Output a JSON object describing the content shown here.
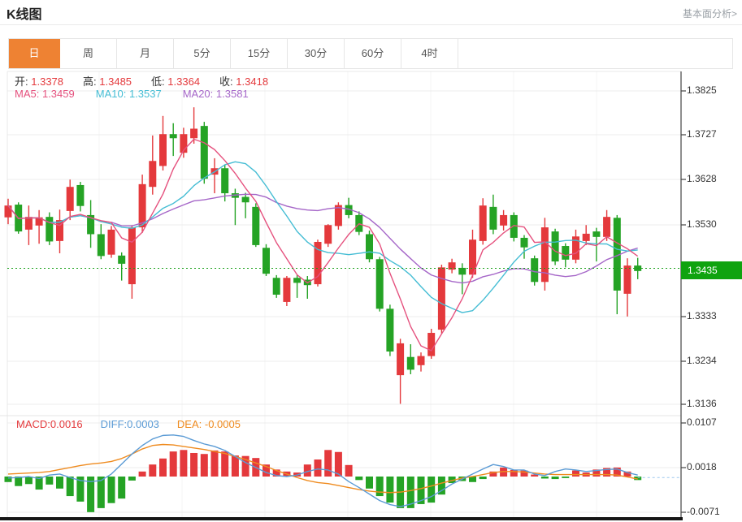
{
  "header": {
    "title": "K线图",
    "link": "基本面分析>"
  },
  "tabs": {
    "items": [
      "日",
      "周",
      "月",
      "5分",
      "15分",
      "30分",
      "60分",
      "4时"
    ],
    "active_index": 0
  },
  "readout": {
    "ohlc": [
      {
        "label": "开:",
        "value": "1.3378"
      },
      {
        "label": "高:",
        "value": "1.3485"
      },
      {
        "label": "低:",
        "value": "1.3364"
      },
      {
        "label": "收:",
        "value": "1.3418"
      }
    ],
    "ma": [
      {
        "label": "MA5:",
        "value": "1.3459"
      },
      {
        "label": "MA10:",
        "value": "1.3537"
      },
      {
        "label": "MA20:",
        "value": "1.3581"
      }
    ],
    "macd": [
      {
        "text": "MACD:0.0016"
      },
      {
        "text": "DIFF:0.0003"
      },
      {
        "text": "DEA: -0.0005"
      }
    ]
  },
  "colors": {
    "up": "#e4393c",
    "down": "#25a325",
    "ma5": "#e5517e",
    "ma10": "#45bdd4",
    "ma20": "#a566c8",
    "diff": "#5b9bd5",
    "dea": "#ef8b1f",
    "accent": "#ee8233",
    "price_tag": "#0fa30f",
    "price_line": "#18a018",
    "grid": "#ececec",
    "vgrid": "#f4f4f4",
    "axis": "#444444"
  },
  "chart_data": {
    "type": "candlestick+macd",
    "title": "K线图 daily candlestick with MA5/MA10/MA20 and MACD",
    "price_axis": {
      "tick_labels": [
        "1.3825",
        "1.3727",
        "1.3628",
        "1.3530",
        "1.3333",
        "1.3234",
        "1.3136"
      ],
      "tick_values": [
        1.3825,
        1.3727,
        1.3628,
        1.353,
        1.3333,
        1.3234,
        1.3136
      ],
      "current_price_label": "1.3435",
      "current_price": 1.3435,
      "range": [
        1.3111,
        1.3868
      ]
    },
    "candles_ohlc": [
      [
        1.3547,
        1.3588,
        1.3532,
        1.3573
      ],
      [
        1.3575,
        1.358,
        1.3511,
        1.3516
      ],
      [
        1.352,
        1.3573,
        1.3486,
        1.3548
      ],
      [
        1.3529,
        1.3563,
        1.3489,
        1.3547
      ],
      [
        1.3548,
        1.3558,
        1.3486,
        1.3494
      ],
      [
        1.3495,
        1.3564,
        1.3468,
        1.3541
      ],
      [
        1.3561,
        1.363,
        1.3541,
        1.3614
      ],
      [
        1.3618,
        1.3625,
        1.356,
        1.3572
      ],
      [
        1.3552,
        1.3585,
        1.348,
        1.351
      ],
      [
        1.351,
        1.3532,
        1.3455,
        1.3462
      ],
      [
        1.3465,
        1.3528,
        1.3458,
        1.352
      ],
      [
        1.3463,
        1.347,
        1.3408,
        1.3445
      ],
      [
        1.34,
        1.353,
        1.3368,
        1.3525
      ],
      [
        1.3525,
        1.3641,
        1.3513,
        1.362
      ],
      [
        1.3614,
        1.3727,
        1.3597,
        1.3671
      ],
      [
        1.366,
        1.377,
        1.365,
        1.373
      ],
      [
        1.373,
        1.3754,
        1.3682,
        1.3721
      ],
      [
        1.3689,
        1.3744,
        1.3678,
        1.373
      ],
      [
        1.3721,
        1.3789,
        1.3709,
        1.3742
      ],
      [
        1.3748,
        1.3757,
        1.3621,
        1.3632
      ],
      [
        1.3641,
        1.3677,
        1.36,
        1.3655
      ],
      [
        1.3655,
        1.3662,
        1.3582,
        1.36
      ],
      [
        1.36,
        1.361,
        1.353,
        1.359
      ],
      [
        1.3592,
        1.3601,
        1.3545,
        1.358
      ],
      [
        1.357,
        1.3578,
        1.3482,
        1.3486
      ],
      [
        1.348,
        1.3488,
        1.3418,
        1.3423
      ],
      [
        1.3414,
        1.342,
        1.337,
        1.3377
      ],
      [
        1.3361,
        1.3418,
        1.3352,
        1.3414
      ],
      [
        1.3414,
        1.342,
        1.337,
        1.3403
      ],
      [
        1.341,
        1.3418,
        1.3368,
        1.3398
      ],
      [
        1.34,
        1.3498,
        1.3395,
        1.3493
      ],
      [
        1.3489,
        1.3532,
        1.3482,
        1.353
      ],
      [
        1.3528,
        1.358,
        1.352,
        1.3574
      ],
      [
        1.3574,
        1.359,
        1.3545,
        1.3552
      ],
      [
        1.3552,
        1.356,
        1.3508,
        1.3515
      ],
      [
        1.351,
        1.3518,
        1.3448,
        1.3455
      ],
      [
        1.3455,
        1.346,
        1.334,
        1.3346
      ],
      [
        1.3346,
        1.3355,
        1.3242,
        1.3252
      ],
      [
        1.32,
        1.328,
        1.3137,
        1.327
      ],
      [
        1.324,
        1.3268,
        1.3202,
        1.3212
      ],
      [
        1.3222,
        1.325,
        1.3208,
        1.3242
      ],
      [
        1.3242,
        1.3302,
        1.3236,
        1.3293
      ],
      [
        1.33,
        1.3443,
        1.3292,
        1.3437
      ],
      [
        1.3432,
        1.3456,
        1.3424,
        1.3448
      ],
      [
        1.3436,
        1.3446,
        1.3378,
        1.3421
      ],
      [
        1.3421,
        1.352,
        1.3414,
        1.3498
      ],
      [
        1.3495,
        1.3589,
        1.3487,
        1.3573
      ],
      [
        1.357,
        1.3597,
        1.351,
        1.352
      ],
      [
        1.3529,
        1.3563,
        1.3518,
        1.3552
      ],
      [
        1.3552,
        1.3558,
        1.3494,
        1.3502
      ],
      [
        1.3502,
        1.3508,
        1.3456,
        1.3481
      ],
      [
        1.3457,
        1.3463,
        1.3397,
        1.3405
      ],
      [
        1.3405,
        1.3546,
        1.3386,
        1.3525
      ],
      [
        1.3516,
        1.3522,
        1.3442,
        1.345
      ],
      [
        1.3484,
        1.349,
        1.3437,
        1.3454
      ],
      [
        1.3454,
        1.352,
        1.3446,
        1.3505
      ],
      [
        1.3495,
        1.353,
        1.3486,
        1.3511
      ],
      [
        1.3516,
        1.3524,
        1.345,
        1.3504
      ],
      [
        1.3504,
        1.3563,
        1.3495,
        1.3548
      ],
      [
        1.3546,
        1.3552,
        1.3334,
        1.3386
      ],
      [
        1.3379,
        1.3457,
        1.3329,
        1.3441
      ],
      [
        1.3441,
        1.3458,
        1.3411,
        1.3429
      ]
    ],
    "ma_periods": [
      5,
      10,
      20
    ],
    "macd": {
      "axis_labels": [
        "0.0107",
        "0.0018",
        "-0.0071"
      ],
      "axis_values": [
        0.0107,
        0.0018,
        -0.0071
      ],
      "hist": [
        -0.0011,
        -0.0019,
        -0.0015,
        -0.0026,
        -0.0016,
        -0.0024,
        -0.0039,
        -0.005,
        -0.0071,
        -0.0063,
        -0.0053,
        -0.0044,
        -0.0008,
        0.001,
        0.0024,
        0.0036,
        0.005,
        0.0053,
        0.0047,
        0.0045,
        0.0052,
        0.005,
        0.0042,
        0.0041,
        0.0037,
        0.0024,
        0.0014,
        0.001,
        0.0008,
        0.0024,
        0.0034,
        0.0053,
        0.0049,
        0.0023,
        -0.0007,
        -0.0024,
        -0.0039,
        -0.0052,
        -0.0063,
        -0.0063,
        -0.0055,
        -0.0052,
        -0.0036,
        -0.0013,
        -0.0009,
        -0.0011,
        -0.0005,
        0.001,
        0.0018,
        0.0013,
        0.0012,
        0.0004,
        -0.0004,
        -0.0005,
        -0.0003,
        0.0012,
        0.0008,
        0.0014,
        0.0017,
        0.0018,
        0.001,
        -0.0007
      ],
      "diff": [
        -0.0003,
        -0.0002,
        0.0,
        -0.0004,
        0.0003,
        0.0005,
        -0.0002,
        -0.0008,
        -0.001,
        -0.0008,
        0.0005,
        0.0025,
        0.0045,
        0.0062,
        0.0075,
        0.0082,
        0.0083,
        0.008,
        0.0072,
        0.0065,
        0.006,
        0.0052,
        0.004,
        0.0028,
        0.0018,
        0.0008,
        0.0002,
        0.0,
        0.0003,
        0.001,
        0.0015,
        0.0013,
        0.0005,
        -0.001,
        -0.0022,
        -0.0035,
        -0.0048,
        -0.0056,
        -0.006,
        -0.0055,
        -0.0048,
        -0.004,
        -0.0028,
        -0.0015,
        -0.0005,
        0.0005,
        0.0015,
        0.0024,
        0.002,
        0.0013,
        0.0013,
        0.0005,
        0.0002,
        0.001,
        0.0015,
        0.0013,
        0.001,
        0.0012,
        0.0014,
        0.0015,
        0.0008,
        0.0003
      ],
      "dea": [
        0.0005,
        0.0006,
        0.0007,
        0.0008,
        0.001,
        0.0014,
        0.0018,
        0.0022,
        0.0025,
        0.0027,
        0.003,
        0.0036,
        0.0045,
        0.0055,
        0.0062,
        0.0064,
        0.0063,
        0.006,
        0.0057,
        0.0054,
        0.005,
        0.0046,
        0.004,
        0.0034,
        0.0027,
        0.002,
        0.0012,
        0.0005,
        -0.0002,
        -0.0008,
        -0.0012,
        -0.0014,
        -0.0018,
        -0.0022,
        -0.0026,
        -0.0029,
        -0.0031,
        -0.0032,
        -0.0031,
        -0.0028,
        -0.0024,
        -0.0019,
        -0.0013,
        -0.0008,
        -0.0003,
        0.0,
        0.0004,
        0.0008,
        0.001,
        0.001,
        0.0009,
        0.0007,
        0.0005,
        0.0004,
        0.0004,
        0.0004,
        0.0004,
        0.0004,
        0.0004,
        0.0003,
        -0.0001,
        -0.0005
      ],
      "tail_value": -0.0002
    }
  }
}
